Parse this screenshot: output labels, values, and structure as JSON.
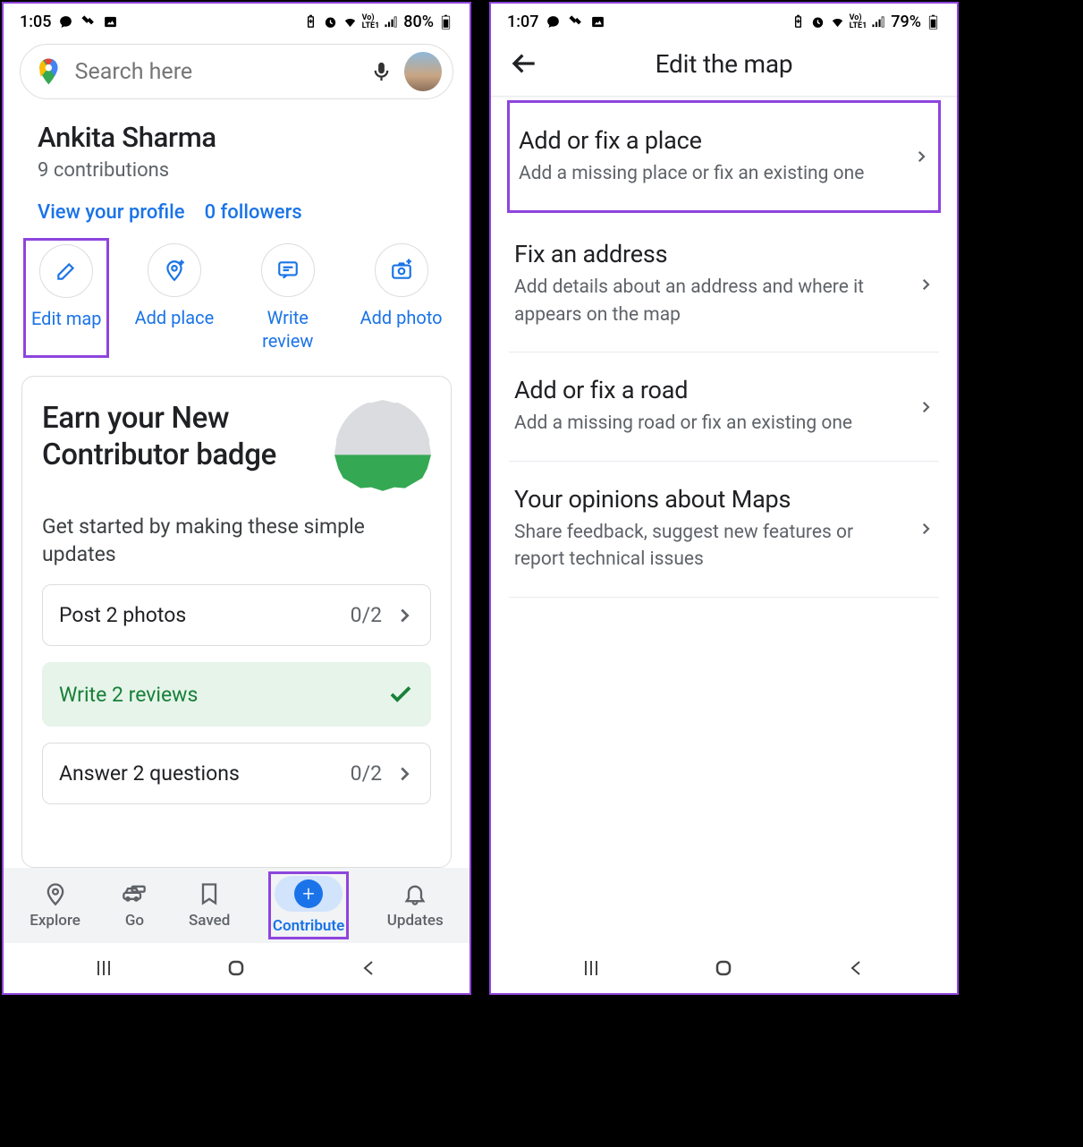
{
  "left": {
    "statusbar": {
      "time": "1:05",
      "battery": "80%"
    },
    "search": {
      "placeholder": "Search here"
    },
    "user": {
      "name": "Ankita Sharma",
      "contributions": "9 contributions",
      "profile_link": "View your profile",
      "followers": "0 followers"
    },
    "actions": {
      "edit_map": "Edit map",
      "add_place": "Add place",
      "write_review": "Write review",
      "add_photo": "Add photo"
    },
    "card": {
      "title": "Earn your New Contributor badge",
      "subtitle": "Get started by making these simple updates",
      "tasks": [
        {
          "label": "Post 2 photos",
          "status": "0/2",
          "done": false
        },
        {
          "label": "Write 2 reviews",
          "status": "",
          "done": true
        },
        {
          "label": "Answer 2 questions",
          "status": "0/2",
          "done": false
        }
      ]
    },
    "bottomnav": {
      "explore": "Explore",
      "go": "Go",
      "saved": "Saved",
      "contribute": "Contribute",
      "updates": "Updates"
    }
  },
  "right": {
    "statusbar": {
      "time": "1:07",
      "battery": "79%"
    },
    "appbar": {
      "title": "Edit the map"
    },
    "items": [
      {
        "title": "Add or fix a place",
        "subtitle": "Add a missing place or fix an existing one"
      },
      {
        "title": "Fix an address",
        "subtitle": "Add details about an address and where it appears on the map"
      },
      {
        "title": "Add or fix a road",
        "subtitle": "Add a missing road or fix an existing one"
      },
      {
        "title": "Your opinions about Maps",
        "subtitle": "Share feedback, suggest new features or report technical issues"
      }
    ]
  }
}
